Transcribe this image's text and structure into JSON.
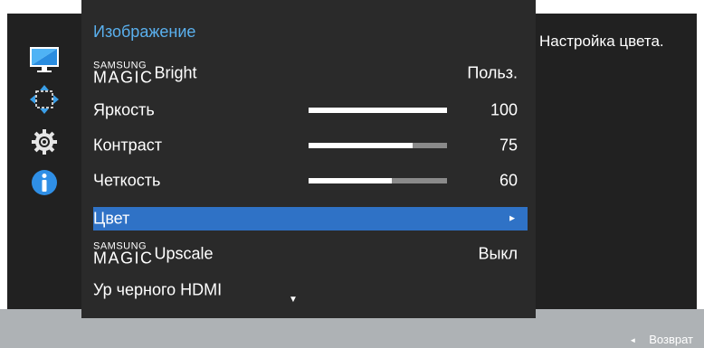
{
  "menu": {
    "title": "Изображение",
    "items": [
      {
        "brand": "SAMSUNG",
        "magic": "MAGIC",
        "label": "Bright",
        "value": "Польз."
      },
      {
        "label": "Яркость",
        "value": "100",
        "level": 100
      },
      {
        "label": "Контраст",
        "value": "75",
        "level": 75
      },
      {
        "label": "Четкость",
        "value": "60",
        "level": 60
      },
      {
        "label": "Цвет",
        "arrow": "►"
      },
      {
        "brand": "SAMSUNG",
        "magic": "MAGIC",
        "label": "Upscale",
        "value": "Выкл"
      },
      {
        "label": "Ур черного HDMI"
      }
    ],
    "scroll_indicator": "▼"
  },
  "help": {
    "text": "Настройка цвета."
  },
  "footer": {
    "back_icon": "◄",
    "back_label": "Возврат"
  },
  "sidebar": {
    "icons": [
      "picture-icon",
      "position-icon",
      "settings-gear-icon",
      "info-icon"
    ]
  },
  "colors": {
    "title": "#5ab0ee",
    "selection": "#2f72c6",
    "panel": "#2a2a2a",
    "bar": "#aeb2b5"
  }
}
